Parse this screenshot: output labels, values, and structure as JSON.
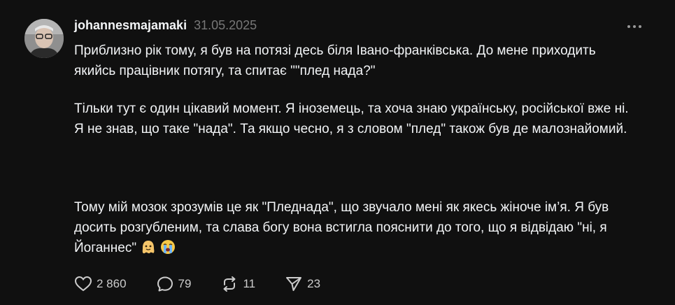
{
  "post": {
    "username": "johannesmajamaki",
    "date": "31.05.2025",
    "paragraphs": {
      "p1": "Приблизно рік тому, я був на потязі десь біля Івано-франківська. До мене приходить якийсь працівник потягу, та спитає \"\"плед нада?\"",
      "p2_line1": "Тільки тут є один цікавий момент. Я іноземець, та хоча знаю українську, російської вже ні.",
      "p2_line2": "Я не знав, що таке \"нада\". Та якщо чесно, я з словом \"плед\" також був де малознайомий.",
      "p3": "Тому мій мозок зрозумів це як \"Пледнада\", що звучало мені як якесь жіноче ім’я. Я був досить розгубленим, та слава богу вона встигла пояснити до того, що я відвідаю \"ні, я Йоганнес\""
    },
    "emojis": [
      "sweat-smile-ghost-emoji",
      "crying-face-emoji"
    ]
  },
  "actions": {
    "likes": "2 860",
    "replies": "79",
    "reposts": "11",
    "shares": "23"
  },
  "icons": {
    "more": "more-dots-icon",
    "like": "heart-icon",
    "reply": "comment-bubble-icon",
    "repost": "repost-arrows-icon",
    "share": "send-plane-icon"
  },
  "colors": {
    "background": "#101010",
    "text": "#f3f5f7",
    "muted": "#777777"
  }
}
